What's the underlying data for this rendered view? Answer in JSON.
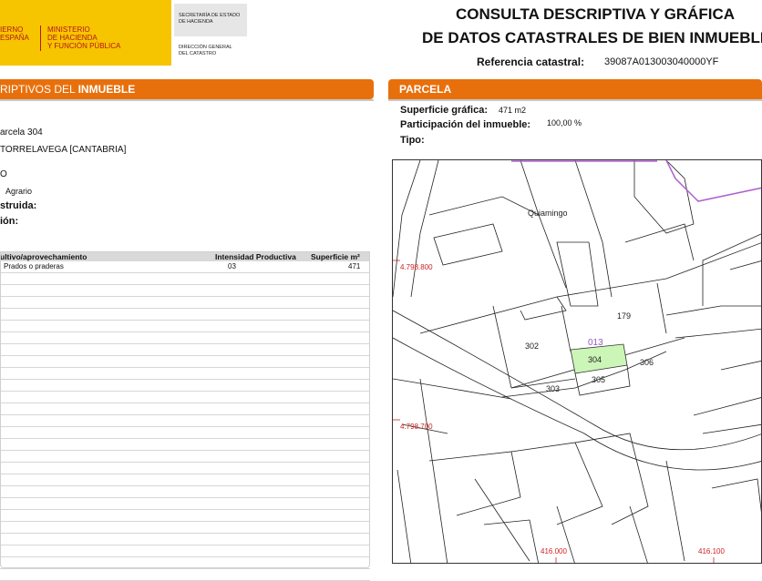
{
  "logo": {
    "ministry_line1": "Ministerio",
    "ministry_line2": "de Hacienda",
    "ministry_line3": "y Función Pública",
    "country_line1": "ierno",
    "country_line2": "España",
    "sec_line1": "Secretaría de Estado",
    "sec_line2": "de Hacienda",
    "dg_line1": "Dirección General",
    "dg_line2": "del Catastro"
  },
  "header": {
    "title_line1": "CONSULTA DESCRIPTIVA Y GRÁFICA",
    "title_line2": "DE DATOS CATASTRALES DE BIEN INMUEBLE",
    "ref_label": "Referencia catastral:",
    "ref_value": "39087A013003040000YF"
  },
  "left": {
    "bar_label_normal": "RIPTIVOS DEL ",
    "bar_label_bold": "INMUEBLE",
    "line1": "arcela 304",
    "line2": "TORRELAVEGA [CANTABRIA]",
    "line3": "O",
    "line4": "Agrario",
    "line5": "struida:",
    "line6": "ión:"
  },
  "table": {
    "headers": [
      "ultivo/aprovechamiento",
      "Intensidad Productiva",
      "Superficie m²"
    ],
    "rows": [
      [
        "Prados o praderas",
        "03",
        "471"
      ]
    ]
  },
  "right": {
    "bar_label": "PARCELA",
    "sup_label": "Superficie gráfica:",
    "sup_value": "471 m2",
    "part_label": "Participación del inmueble:",
    "part_value": "100,00 %",
    "tipo_label": "Tipo:"
  },
  "map": {
    "place": "Quiamingo",
    "coord_y1": "4.798.800",
    "coord_y2": "4.798.700",
    "coord_x1": "416.000",
    "coord_x2": "416.100",
    "parcel_013": "013",
    "parcel_179": "179",
    "parcel_302": "302",
    "parcel_303": "303",
    "parcel_304": "304",
    "parcel_305": "305",
    "parcel_306": "306",
    "highlight_color": "#ccf5b8",
    "boundary_color": "#b060d0"
  }
}
